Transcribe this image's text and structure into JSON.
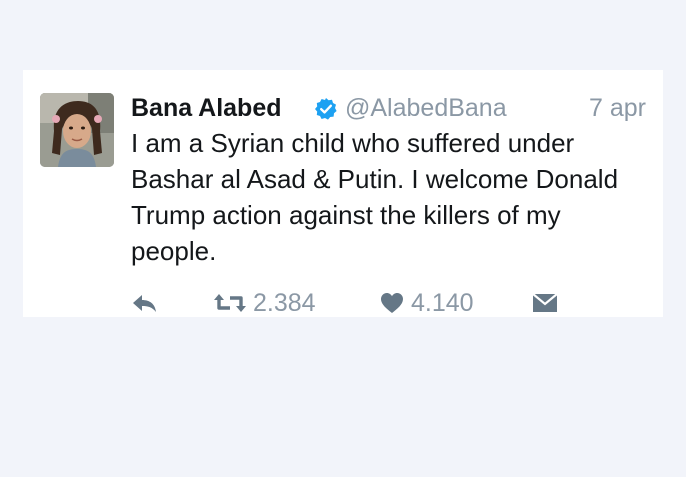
{
  "tweet": {
    "display_name": "Bana Alabed",
    "verified": true,
    "handle": "@AlabedBana",
    "timestamp": "7 apr",
    "text": "I am a Syrian child who suffered under Bashar al Asad & Putin. I welcome Donald Trump action against the killers of my people.",
    "actions": {
      "reply": {
        "icon": "reply-icon"
      },
      "retweet": {
        "icon": "retweet-icon",
        "count": "2.384"
      },
      "like": {
        "icon": "heart-icon",
        "count": "4.140"
      },
      "direct_message": {
        "icon": "envelope-icon"
      }
    }
  },
  "colors": {
    "page_background": "#f2f4fa",
    "card_background": "#ffffff",
    "text_primary": "#14171a",
    "text_secondary": "#8b98a5",
    "verified_blue": "#1da1f2",
    "icon_gray": "#657786"
  }
}
